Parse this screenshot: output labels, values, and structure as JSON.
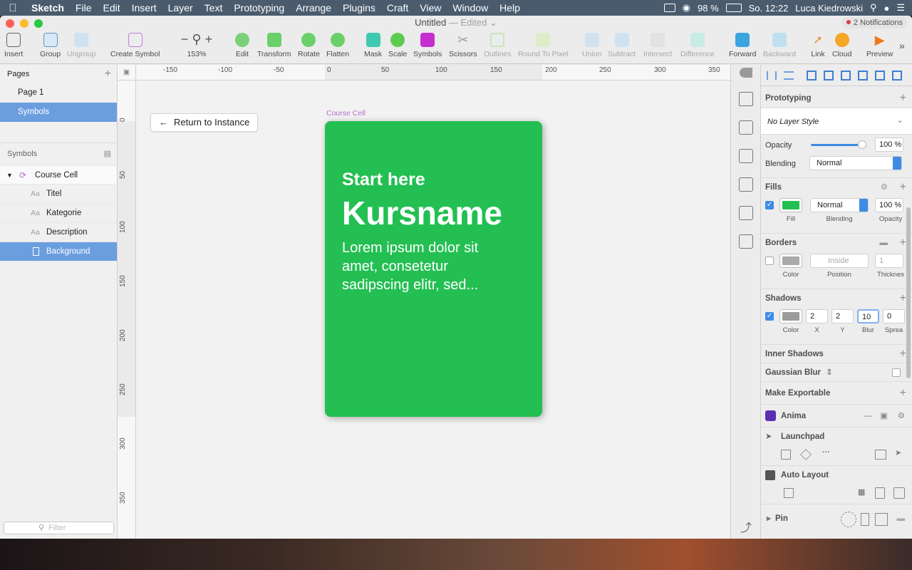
{
  "menubar": {
    "app": "Sketch",
    "items": [
      "File",
      "Edit",
      "Insert",
      "Layer",
      "Text",
      "Prototyping",
      "Arrange",
      "Plugins",
      "Craft",
      "View",
      "Window",
      "Help"
    ],
    "battery": "98 %",
    "clock": "So. 12:22",
    "user": "Luca Kiedrowski"
  },
  "window": {
    "title": "Untitled",
    "edited": "— Edited",
    "notifications": "2 Notifications"
  },
  "toolbar": {
    "insert": "Insert",
    "group": "Group",
    "ungroup": "Ungroup",
    "create_symbol": "Create Symbol",
    "zoom": "153%",
    "edit": "Edit",
    "transform": "Transform",
    "rotate": "Rotate",
    "flatten": "Flatten",
    "mask": "Mask",
    "scale": "Scale",
    "symbols": "Symbols",
    "scissors": "Scissors",
    "outlines": "Outlines",
    "round": "Round To Pixel",
    "union": "Union",
    "subtract": "Subtract",
    "intersect": "Intersect",
    "difference": "Difference",
    "forward": "Forward",
    "backward": "Backward",
    "link": "Link",
    "cloud": "Cloud",
    "preview": "Preview"
  },
  "pages": {
    "title": "Pages",
    "items": [
      "Page 1",
      "Symbols"
    ]
  },
  "layers": {
    "title": "Symbols",
    "symbol": "Course Cell",
    "items": [
      "Titel",
      "Kategorie",
      "Description",
      "Background"
    ],
    "filter_placeholder": "Filter"
  },
  "ruler": {
    "h": [
      "-150",
      "-100",
      "-50",
      "0",
      "50",
      "100",
      "150",
      "200",
      "250",
      "300",
      "350"
    ],
    "v": [
      "0",
      "50",
      "100",
      "150",
      "200",
      "250",
      "300",
      "350"
    ]
  },
  "canvas": {
    "return_label": "Return to Instance",
    "artboard_label": "Course Cell",
    "card": {
      "tagline": "Start here",
      "title": "Kursname",
      "description": "Lorem ipsum dolor sit amet, consetetur sadipscing elitr, sed...",
      "color": "#23bf52"
    }
  },
  "inspector": {
    "prototyping": "Prototyping",
    "layer_style": "No Layer Style",
    "opacity_label": "Opacity",
    "opacity_value": "100 %",
    "opacity": 1.0,
    "blending_label": "Blending",
    "blending_value": "Normal",
    "fills": {
      "title": "Fills",
      "blend": "Normal",
      "opacity": "100 %",
      "sub_fill": "Fill",
      "sub_blend": "Blending",
      "sub_opacity": "Opacity",
      "color": "#23bf52"
    },
    "borders": {
      "title": "Borders",
      "position": "Inside",
      "thickness": "1",
      "sub_color": "Color",
      "sub_position": "Position",
      "sub_thickness": "Thicknes"
    },
    "shadows": {
      "title": "Shadows",
      "x": "2",
      "y": "2",
      "blur": "10",
      "spread": "0",
      "sub_color": "Color",
      "sub_x": "X",
      "sub_y": "Y",
      "sub_blur": "Blur",
      "sub_spread": "Sprea"
    },
    "inner_shadows": "Inner Shadows",
    "gaussian_blur": "Gaussian Blur",
    "make_exportable": "Make Exportable",
    "anima": "Anima",
    "launchpad": "Launchpad",
    "auto_layout": "Auto Layout",
    "pin": "Pin"
  }
}
